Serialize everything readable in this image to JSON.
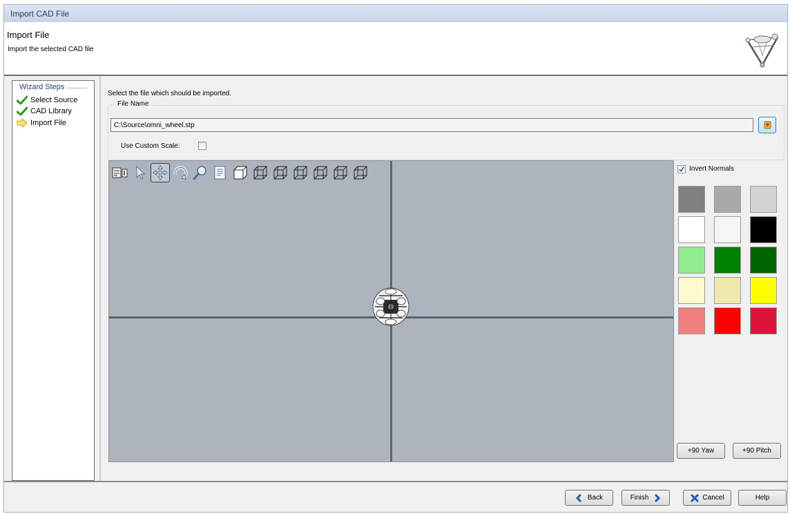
{
  "window": {
    "title": "Import CAD File"
  },
  "header": {
    "title": "Import File",
    "subtitle": "Import the selected CAD file"
  },
  "wizard": {
    "legend": "Wizard Steps",
    "steps": [
      {
        "label": "Select Source",
        "status": "done"
      },
      {
        "label": "CAD Library",
        "status": "done"
      },
      {
        "label": "Import File",
        "status": "current"
      }
    ]
  },
  "main": {
    "prompt": "Select the file which should be imported.",
    "file_group": {
      "legend": "File Name",
      "path": "C:\\Source\\omni_wheel.stp",
      "custom_scale_label": "Use Custom Scale:",
      "custom_scale_checked": false
    }
  },
  "viewer": {
    "background": "#adb4bd",
    "toolbar": [
      "selection-list-icon",
      "pointer-icon",
      "pan-icon",
      "rotate-icon",
      "zoom-icon",
      "properties-icon",
      "view-cube-icon",
      "view-front-icon",
      "view-back-icon",
      "view-left-icon",
      "view-right-icon",
      "view-top-icon",
      "view-bottom-icon"
    ],
    "active_tool": "pan-icon"
  },
  "appearance": {
    "invert_normals_label": "Invert Normals",
    "invert_normals_checked": true,
    "colors": [
      "#808080",
      "#a9a9a9",
      "#d3d3d3",
      "#ffffff",
      "#f5f5f5",
      "#000000",
      "#90ee90",
      "#008000",
      "#006400",
      "#fffacd",
      "#eee8aa",
      "#ffff00",
      "#f08080",
      "#ff0000",
      "#dc143c"
    ],
    "yaw_button": "+90 Yaw",
    "pitch_button": "+90 Pitch"
  },
  "footer": {
    "back": "Back",
    "finish": "Finish",
    "cancel": "Cancel",
    "help": "Help"
  }
}
